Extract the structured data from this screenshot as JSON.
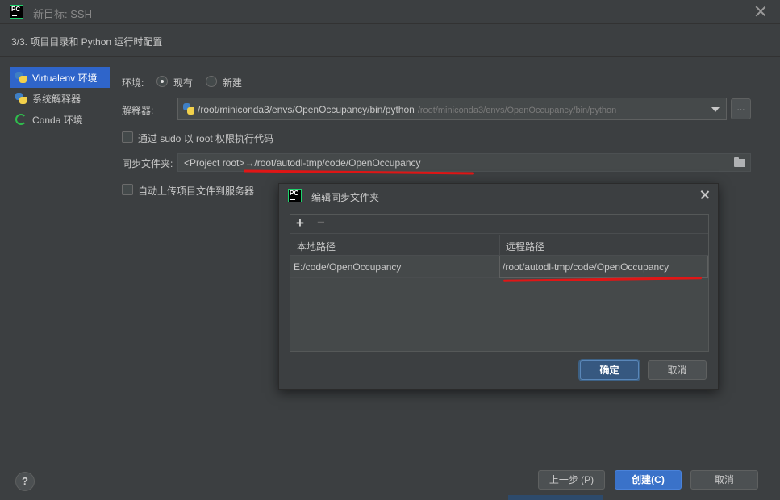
{
  "window": {
    "title": "新目标: SSH"
  },
  "step": {
    "text": "3/3. 项目目录和 Python 运行时配置"
  },
  "env_types": [
    {
      "label": "Virtualenv 环境",
      "icon": "python-icon",
      "selected": true
    },
    {
      "label": "系统解释器",
      "icon": "python-icon",
      "selected": false
    },
    {
      "label": "Conda 环境",
      "icon": "conda-icon",
      "selected": false
    }
  ],
  "form": {
    "env_label": "环境:",
    "env_option_existing": "现有",
    "env_option_new": "新建",
    "interpreter_label": "解释器:",
    "interpreter_value": "/root/miniconda3/envs/OpenOccupancy/bin/python",
    "interpreter_hint": "/root/miniconda3/envs/OpenOccupancy/bin/python",
    "interpreter_more": "...",
    "sudo_label": "通过 sudo 以 root 权限执行代码",
    "sync_label": "同步文件夹:",
    "sync_value": "<Project root>→/root/autodl-tmp/code/OpenOccupancy",
    "auto_upload_label": "自动上传项目文件到服务器"
  },
  "dialog": {
    "title": "编辑同步文件夹",
    "toolbar": {
      "add": "+",
      "remove": "−"
    },
    "columns": [
      "本地路径",
      "远程路径"
    ],
    "rows": [
      {
        "local": "E:/code/OpenOccupancy",
        "remote": "/root/autodl-tmp/code/OpenOccupancy"
      }
    ],
    "ok_label": "确定",
    "cancel_label": "取消"
  },
  "footer": {
    "help": "?",
    "prev_label": "上一步 (P)",
    "create_label": "创建(C)",
    "cancel_label": "取消"
  },
  "colors": {
    "background": "#3c3f41",
    "selection": "#2f65ca",
    "primary_button": "#365880",
    "annotation_red": "#e01616"
  }
}
